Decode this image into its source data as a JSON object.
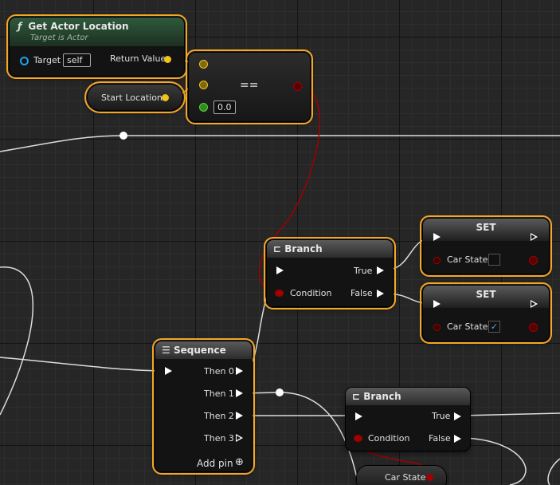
{
  "get_actor_location": {
    "icon": "function-icon",
    "title": "Get Actor Location",
    "subtitle": "Target is Actor",
    "target_label": "Target",
    "target_value": "self",
    "return_label": "Return Value"
  },
  "start_location": {
    "label": "Start Location"
  },
  "equals": {
    "op": "==",
    "tolerance": "0.0"
  },
  "branch1": {
    "title": "Branch",
    "true_label": "True",
    "condition_label": "Condition",
    "false_label": "False"
  },
  "set1": {
    "title": "SET",
    "var_label": "Car State",
    "checked": false
  },
  "set2": {
    "title": "SET",
    "var_label": "Car State",
    "checked": true,
    "check_glyph": "✓"
  },
  "sequence": {
    "title": "Sequence",
    "outputs": [
      "Then 0",
      "Then 1",
      "Then 2",
      "Then 3"
    ],
    "add_pin": "Add pin",
    "add_glyph": "⊕"
  },
  "branch2": {
    "title": "Branch",
    "true_label": "True",
    "condition_label": "Condition",
    "false_label": "False"
  },
  "car_state_getter": {
    "label": "Car State"
  },
  "colors": {
    "selection": "#f5a623",
    "exec": "#ffffff",
    "vector_pin": "#f0c419",
    "bool_pin": "#a20000",
    "float_pin": "#5fd33a",
    "object_pin": "#1aa3e8"
  }
}
